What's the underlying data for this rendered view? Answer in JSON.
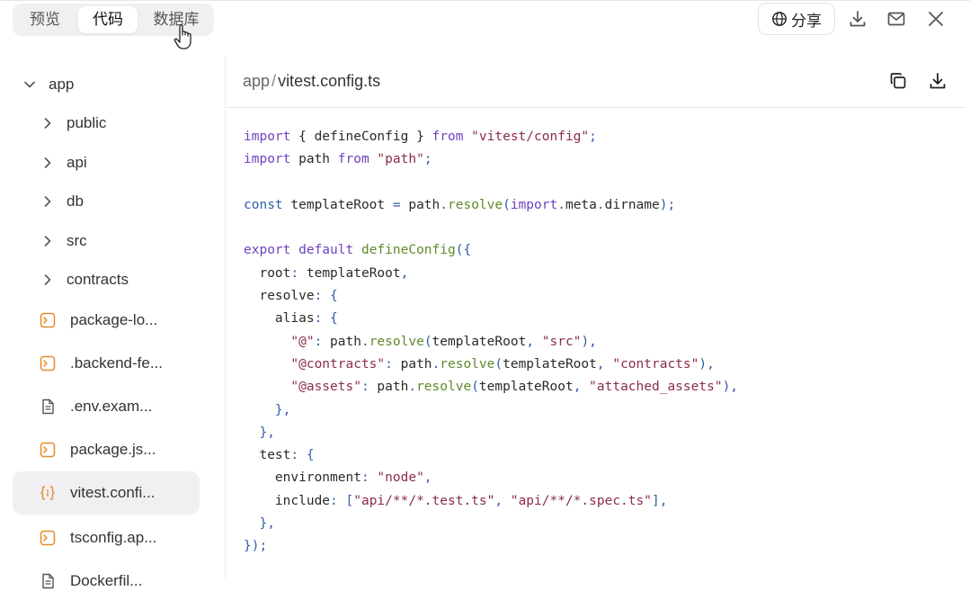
{
  "tabs": [
    {
      "label": "预览",
      "active": false
    },
    {
      "label": "代码",
      "active": true
    },
    {
      "label": "数据库",
      "active": false
    }
  ],
  "actions": {
    "share_label": "分享"
  },
  "sidebar": {
    "root": {
      "label": "app",
      "expanded": true
    },
    "folders": [
      {
        "label": "public"
      },
      {
        "label": "api"
      },
      {
        "label": "db"
      },
      {
        "label": "src"
      },
      {
        "label": "contracts"
      }
    ],
    "files": [
      {
        "label": "package-lo...",
        "icon": "terminal-file-icon"
      },
      {
        "label": ".backend-fe...",
        "icon": "terminal-file-icon"
      },
      {
        "label": ".env.exam...",
        "icon": "document-file-icon"
      },
      {
        "label": "package.js...",
        "icon": "terminal-file-icon"
      },
      {
        "label": "vitest.confi...",
        "icon": "code-file-icon",
        "selected": true
      },
      {
        "label": "tsconfig.ap...",
        "icon": "terminal-file-icon"
      },
      {
        "label": "Dockerfil...",
        "icon": "document-file-icon"
      }
    ]
  },
  "editor": {
    "path_root": "app",
    "path_sep": "/",
    "path_file": "vitest.config.ts",
    "code_lines": [
      [
        [
          "kw",
          "import"
        ],
        [
          "key",
          " { defineConfig } "
        ],
        [
          "kw",
          "from"
        ],
        [
          "str",
          " \"vitest/config\""
        ],
        [
          "punc",
          ";"
        ]
      ],
      [
        [
          "kw",
          "import"
        ],
        [
          "key",
          " path "
        ],
        [
          "kw",
          "from"
        ],
        [
          "str",
          " \"path\""
        ],
        [
          "punc",
          ";"
        ]
      ],
      [],
      [
        [
          "kw2",
          "const"
        ],
        [
          "key",
          " templateRoot "
        ],
        [
          "punc",
          "="
        ],
        [
          "key",
          " path"
        ],
        [
          "punc",
          "."
        ],
        [
          "fn",
          "resolve"
        ],
        [
          "punc",
          "("
        ],
        [
          "kw",
          "import"
        ],
        [
          "punc",
          "."
        ],
        [
          "key",
          "meta"
        ],
        [
          "punc",
          "."
        ],
        [
          "key",
          "dirname"
        ],
        [
          "punc",
          ");"
        ]
      ],
      [],
      [
        [
          "kw",
          "export"
        ],
        [
          "kw",
          " default"
        ],
        [
          "fn",
          " defineConfig"
        ],
        [
          "punc",
          "({"
        ]
      ],
      [
        [
          "key",
          "  root"
        ],
        [
          "punc",
          ":"
        ],
        [
          "key",
          " templateRoot"
        ],
        [
          "punc",
          ","
        ]
      ],
      [
        [
          "key",
          "  resolve"
        ],
        [
          "punc",
          ":"
        ],
        [
          "punc",
          " {"
        ]
      ],
      [
        [
          "key",
          "    alias"
        ],
        [
          "punc",
          ":"
        ],
        [
          "punc",
          " {"
        ]
      ],
      [
        [
          "str",
          "      \"@\""
        ],
        [
          "punc",
          ":"
        ],
        [
          "key",
          " path"
        ],
        [
          "punc",
          "."
        ],
        [
          "fn",
          "resolve"
        ],
        [
          "punc",
          "("
        ],
        [
          "key",
          "templateRoot"
        ],
        [
          "punc",
          ","
        ],
        [
          "str",
          " \"src\""
        ],
        [
          "punc",
          "),"
        ]
      ],
      [
        [
          "str",
          "      \"@contracts\""
        ],
        [
          "punc",
          ":"
        ],
        [
          "key",
          " path"
        ],
        [
          "punc",
          "."
        ],
        [
          "fn",
          "resolve"
        ],
        [
          "punc",
          "("
        ],
        [
          "key",
          "templateRoot"
        ],
        [
          "punc",
          ","
        ],
        [
          "str",
          " \"contracts\""
        ],
        [
          "punc",
          "),"
        ]
      ],
      [
        [
          "str",
          "      \"@assets\""
        ],
        [
          "punc",
          ":"
        ],
        [
          "key",
          " path"
        ],
        [
          "punc",
          "."
        ],
        [
          "fn",
          "resolve"
        ],
        [
          "punc",
          "("
        ],
        [
          "key",
          "templateRoot"
        ],
        [
          "punc",
          ","
        ],
        [
          "str",
          " \"attached_assets\""
        ],
        [
          "punc",
          "),"
        ]
      ],
      [
        [
          "punc",
          "    },"
        ]
      ],
      [
        [
          "punc",
          "  },"
        ]
      ],
      [
        [
          "key",
          "  test"
        ],
        [
          "punc",
          ":"
        ],
        [
          "punc",
          " {"
        ]
      ],
      [
        [
          "key",
          "    environment"
        ],
        [
          "punc",
          ":"
        ],
        [
          "str",
          " \"node\""
        ],
        [
          "punc",
          ","
        ]
      ],
      [
        [
          "key",
          "    include"
        ],
        [
          "punc",
          ":"
        ],
        [
          "punc",
          " ["
        ],
        [
          "str",
          "\"api/**/*.test.ts\""
        ],
        [
          "punc",
          ","
        ],
        [
          "str",
          " \"api/**/*.spec.ts\""
        ],
        [
          "punc",
          "],"
        ]
      ],
      [
        [
          "punc",
          "  },"
        ]
      ],
      [
        [
          "punc",
          "});"
        ]
      ]
    ]
  }
}
